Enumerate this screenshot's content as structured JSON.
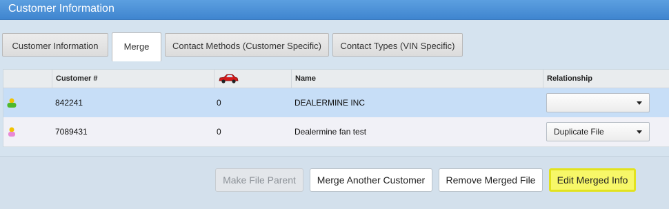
{
  "window": {
    "title": "Customer Information"
  },
  "tabs": [
    {
      "label": "Customer Information",
      "active": false
    },
    {
      "label": "Merge",
      "active": true
    },
    {
      "label": "Contact Methods (Customer Specific)",
      "active": false
    },
    {
      "label": "Contact Types (VIN Specific)",
      "active": false
    }
  ],
  "grid": {
    "columns": {
      "customer_number": "Customer #",
      "vehicles_icon": "car-icon",
      "name": "Name",
      "relationship": "Relationship"
    },
    "rows": [
      {
        "icon": "person-green-icon",
        "customer_number": "842241",
        "vehicles": "0",
        "name": "DEALERMINE INC",
        "relationship": "",
        "selected": true
      },
      {
        "icon": "person-pink-icon",
        "customer_number": "7089431",
        "vehicles": "0",
        "name": "Dealermine fan test",
        "relationship": "Duplicate File",
        "selected": false
      }
    ]
  },
  "actions": {
    "make_parent": "Make File Parent",
    "merge_another": "Merge Another Customer",
    "remove_merged": "Remove Merged File",
    "edit_merged": "Edit Merged Info"
  },
  "colors": {
    "title_bar": "#4a90d9",
    "selected_row": "#c7def7",
    "highlight_button": "#f7f768"
  }
}
